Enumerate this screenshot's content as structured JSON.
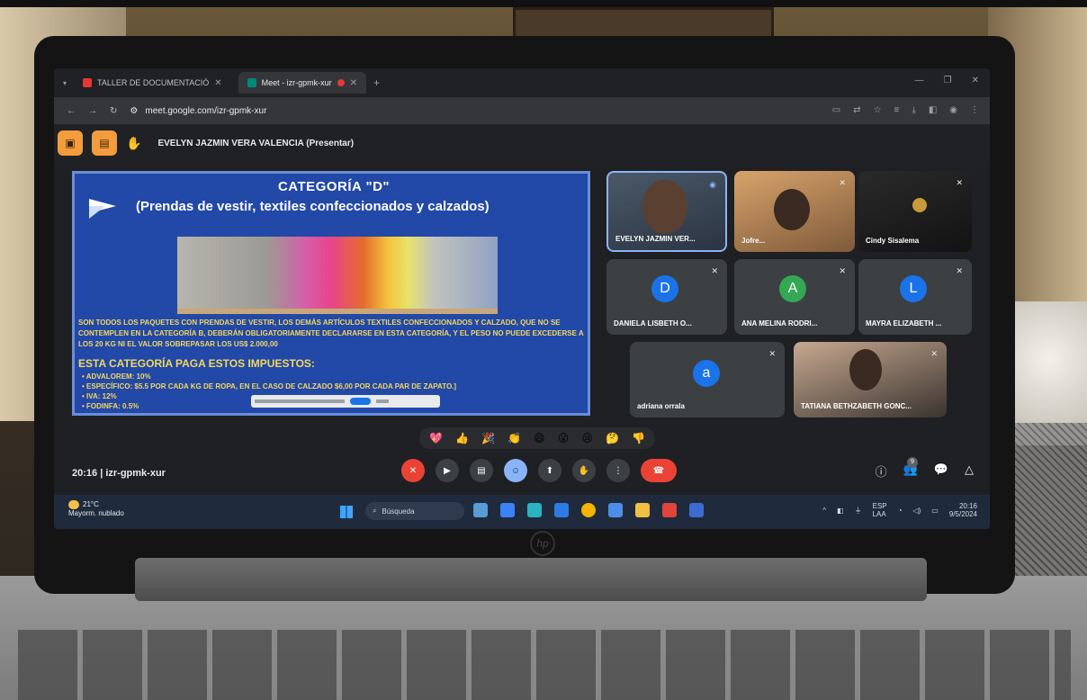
{
  "browser": {
    "tabs": [
      {
        "label": "TALLER DE DOCUMENTACIÓ",
        "active": false
      },
      {
        "label": "Meet - izr-gpmk-xur",
        "active": true
      }
    ],
    "new_tab_symbol": "+",
    "url": "meet.google.com/izr-gpmk-xur"
  },
  "meet": {
    "presenter_label": "EVELYN JAZMIN VERA VALENCIA (Presentar)",
    "slide": {
      "title": "CATEGORÍA    \"D\"",
      "subtitle": "(Prendas de vestir, textiles confeccionados y calzados)",
      "body": "SON TODOS LOS PAQUETES CON PRENDAS DE VESTIR, LOS DEMÁS ARTÍCULOS TEXTILES CONFECCIONADOS Y CALZADO, QUE NO SE CONTEMPLEN EN LA CATEGORÍA B, DEBERÁN OBLIGATORIAMENTE DECLARARSE EN ESTA CATEGORÍA, Y EL PESO NO PUEDE EXCEDERSE A LOS 20 KG NI EL VALOR SOBREPASAR LOS US$ 2.000,00",
      "tax_heading": "ESTA CATEGORÍA PAGA ESTOS IMPUESTOS:",
      "taxes": [
        "ADVALOREM: 10%",
        "ESPECÍFICO: $5.5 POR CADA KG DE ROPA, EN EL CASO DE CALZADO $6,00 POR CADA PAR DE ZAPATO.]",
        "IVA: 12%",
        "FODINFA: 0.5%"
      ]
    },
    "participants": [
      {
        "name": "EVELYN JAZMIN VER...",
        "type": "video"
      },
      {
        "name": "Jofre...",
        "type": "video"
      },
      {
        "name": "Cindy Sisalema",
        "type": "video"
      },
      {
        "name": "DANIELA LISBETH O...",
        "type": "avatar",
        "initial": "D",
        "color": "#1a73e8"
      },
      {
        "name": "ANA MELINA RODRI...",
        "type": "avatar",
        "initial": "A",
        "color": "#34a853"
      },
      {
        "name": "MAYRA ELIZABETH ...",
        "type": "avatar",
        "initial": "L",
        "color": "#1a73e8"
      },
      {
        "name": "adriana orrala",
        "type": "avatar",
        "initial": "a",
        "color": "#1a73e8"
      },
      {
        "name": "TATIANA BETHZABETH GONC...",
        "type": "video"
      }
    ],
    "time_and_code": "20:16  |  izr-gpmk-xur",
    "participant_count": "9",
    "reactions": [
      "💖",
      "👍",
      "🎉",
      "👏",
      "😄",
      "😮",
      "😢",
      "🤔",
      "👎"
    ]
  },
  "taskbar": {
    "weather_temp": "21°C",
    "weather_text": "Mayorm. nublado",
    "search_placeholder": "Búsqueda",
    "lang_top": "ESP",
    "lang_bottom": "LAA",
    "clock_time": "20:16",
    "clock_date": "9/5/2024"
  }
}
